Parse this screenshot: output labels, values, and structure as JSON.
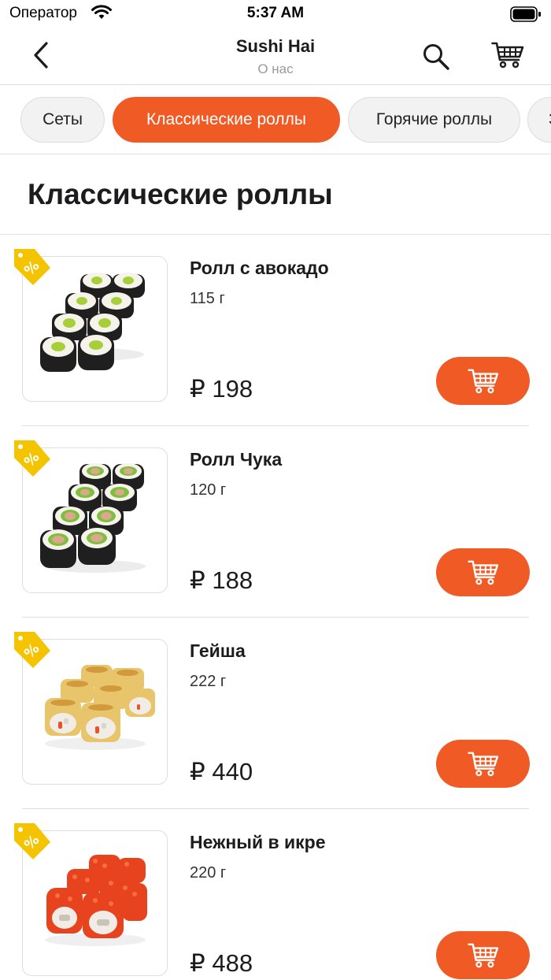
{
  "status_bar": {
    "carrier": "Оператор",
    "time": "5:37 AM"
  },
  "nav": {
    "title": "Sushi Hai",
    "subtitle": "О нас",
    "icons": [
      "chevron-left-icon",
      "search-icon",
      "cart-icon"
    ]
  },
  "tabs": [
    {
      "label": "Сеты",
      "active": false
    },
    {
      "label": "Классические роллы",
      "active": true
    },
    {
      "label": "Горячие роллы",
      "active": false
    },
    {
      "label": "З",
      "active": false
    }
  ],
  "section": {
    "title": "Классические роллы"
  },
  "products": [
    {
      "name": "Ролл с авокадо",
      "weight": "115 г",
      "price": "₽ 198",
      "discount": true,
      "image": "avocado-roll"
    },
    {
      "name": "Ролл Чука",
      "weight": "120 г",
      "price": "₽ 188",
      "discount": true,
      "image": "chuka-roll"
    },
    {
      "name": "Гейша",
      "weight": "222 г",
      "price": "₽ 440",
      "discount": true,
      "image": "geisha-roll"
    },
    {
      "name": "Нежный в икре",
      "weight": "220 г",
      "price": "₽ 488",
      "discount": true,
      "image": "roe-roll"
    }
  ],
  "colors": {
    "accent": "#f05a24",
    "discount_tag": "#f5c400",
    "text_primary": "#1c1c1e",
    "text_secondary": "#9a9a9a"
  }
}
